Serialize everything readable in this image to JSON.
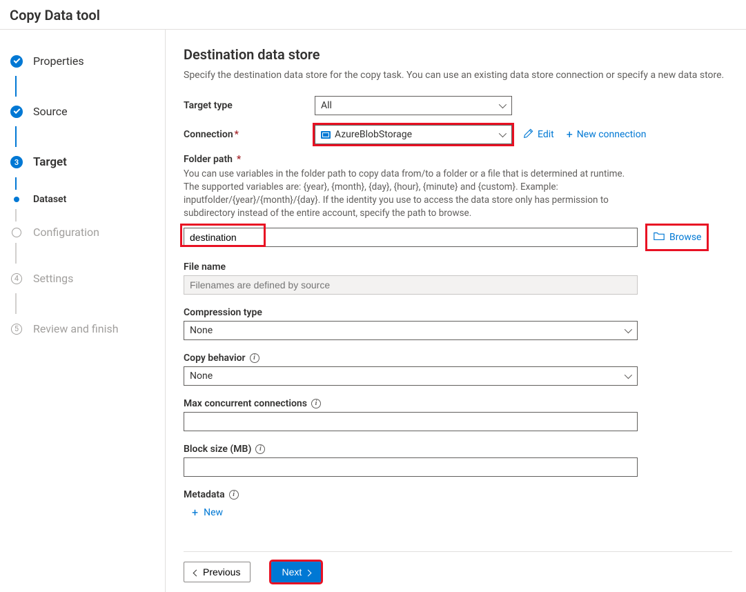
{
  "header": {
    "title": "Copy Data tool"
  },
  "sidebar": {
    "properties": "Properties",
    "source": "Source",
    "target": "Target",
    "target_num": "3",
    "dataset": "Dataset",
    "configuration": "Configuration",
    "settings": "Settings",
    "settings_num": "4",
    "review": "Review and finish",
    "review_num": "5"
  },
  "page": {
    "title": "Destination data store",
    "desc": "Specify the destination data store for the copy task. You can use an existing data store connection or specify a new data store."
  },
  "target_type": {
    "label": "Target type",
    "value": "All"
  },
  "connection": {
    "label": "Connection",
    "value": "AzureBlobStorage",
    "edit": "Edit",
    "new": "New connection"
  },
  "folder_path": {
    "label": "Folder path",
    "help": "You can use variables in the folder path to copy data from/to a folder or a file that is determined at runtime. The supported variables are: {year}, {month}, {day}, {hour}, {minute} and {custom}. Example: inputfolder/{year}/{month}/{day}. If the identity you use to access the data store only has permission to subdirectory instead of the entire account, specify the path to browse.",
    "value": "destination",
    "browse": "Browse"
  },
  "file_name": {
    "label": "File name",
    "placeholder": "Filenames are defined by source"
  },
  "compression": {
    "label": "Compression type",
    "value": "None"
  },
  "copy_behavior": {
    "label": "Copy behavior",
    "value": "None"
  },
  "max_conn": {
    "label": "Max concurrent connections"
  },
  "block_size": {
    "label": "Block size (MB)"
  },
  "metadata": {
    "label": "Metadata",
    "new": "New"
  },
  "footer": {
    "previous": "Previous",
    "next": "Next"
  }
}
